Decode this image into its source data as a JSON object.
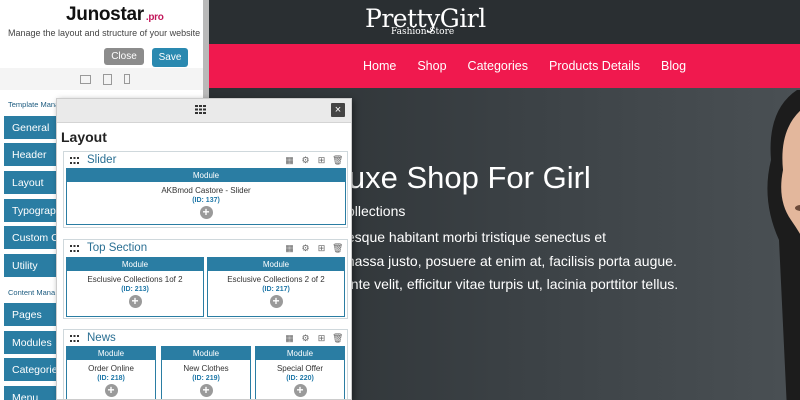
{
  "editor": {
    "brand": "Junostar",
    "brand_pro": ".pro",
    "tagline": "Manage the layout and structure of your website",
    "close_label": "Close",
    "save_label": "Save",
    "template_section_label": "Template Mana",
    "template_items": [
      "General",
      "Header",
      "Layout",
      "Typography",
      "Custom Co",
      "Utility"
    ],
    "content_section_label": "Content Mana",
    "content_items": [
      "Pages",
      "Modules",
      "Categories",
      "Menu"
    ]
  },
  "layout_panel": {
    "title": "Layout",
    "close_icon": "×",
    "sections": [
      {
        "title": "Slider",
        "modules": [
          {
            "header": "Module",
            "name": "AKBmod Castore - Slider",
            "id": "(ID: 137)"
          }
        ]
      },
      {
        "title": "Top Section",
        "modules": [
          {
            "header": "Module",
            "name": "Esclusive Collections 1of 2",
            "id": "(ID: 213)"
          },
          {
            "header": "Module",
            "name": "Esclusive Collections 2 of 2",
            "id": "(ID: 217)"
          }
        ]
      },
      {
        "title": "News",
        "modules": [
          {
            "header": "Module",
            "name": "Order Online",
            "id": "(ID: 218)"
          },
          {
            "header": "Module",
            "name": "New Clothes",
            "id": "(ID: 219)"
          },
          {
            "header": "Module",
            "name": "Special Offer",
            "id": "(ID: 220)"
          }
        ]
      }
    ]
  },
  "site": {
    "logo": "PrettyGirl",
    "logo_sub": "Fashion Store",
    "nav": [
      "Home",
      "Shop",
      "Categories",
      "Products Details",
      "Blog"
    ],
    "hero_title": "luxe Shop For Girl",
    "hero_subtitle": "ollections",
    "hero_lines": [
      "tesque habitant morbi tristique senectus et",
      "massa justo, posuere at enim at, facilisis porta augue.",
      "ante velit, efficitur vitae turpis ut, lacinia porttitor tellus."
    ]
  },
  "colors": {
    "accent_blue": "#2a7da3",
    "nav_pink": "#f0194e",
    "site_dark": "#2f3437"
  }
}
